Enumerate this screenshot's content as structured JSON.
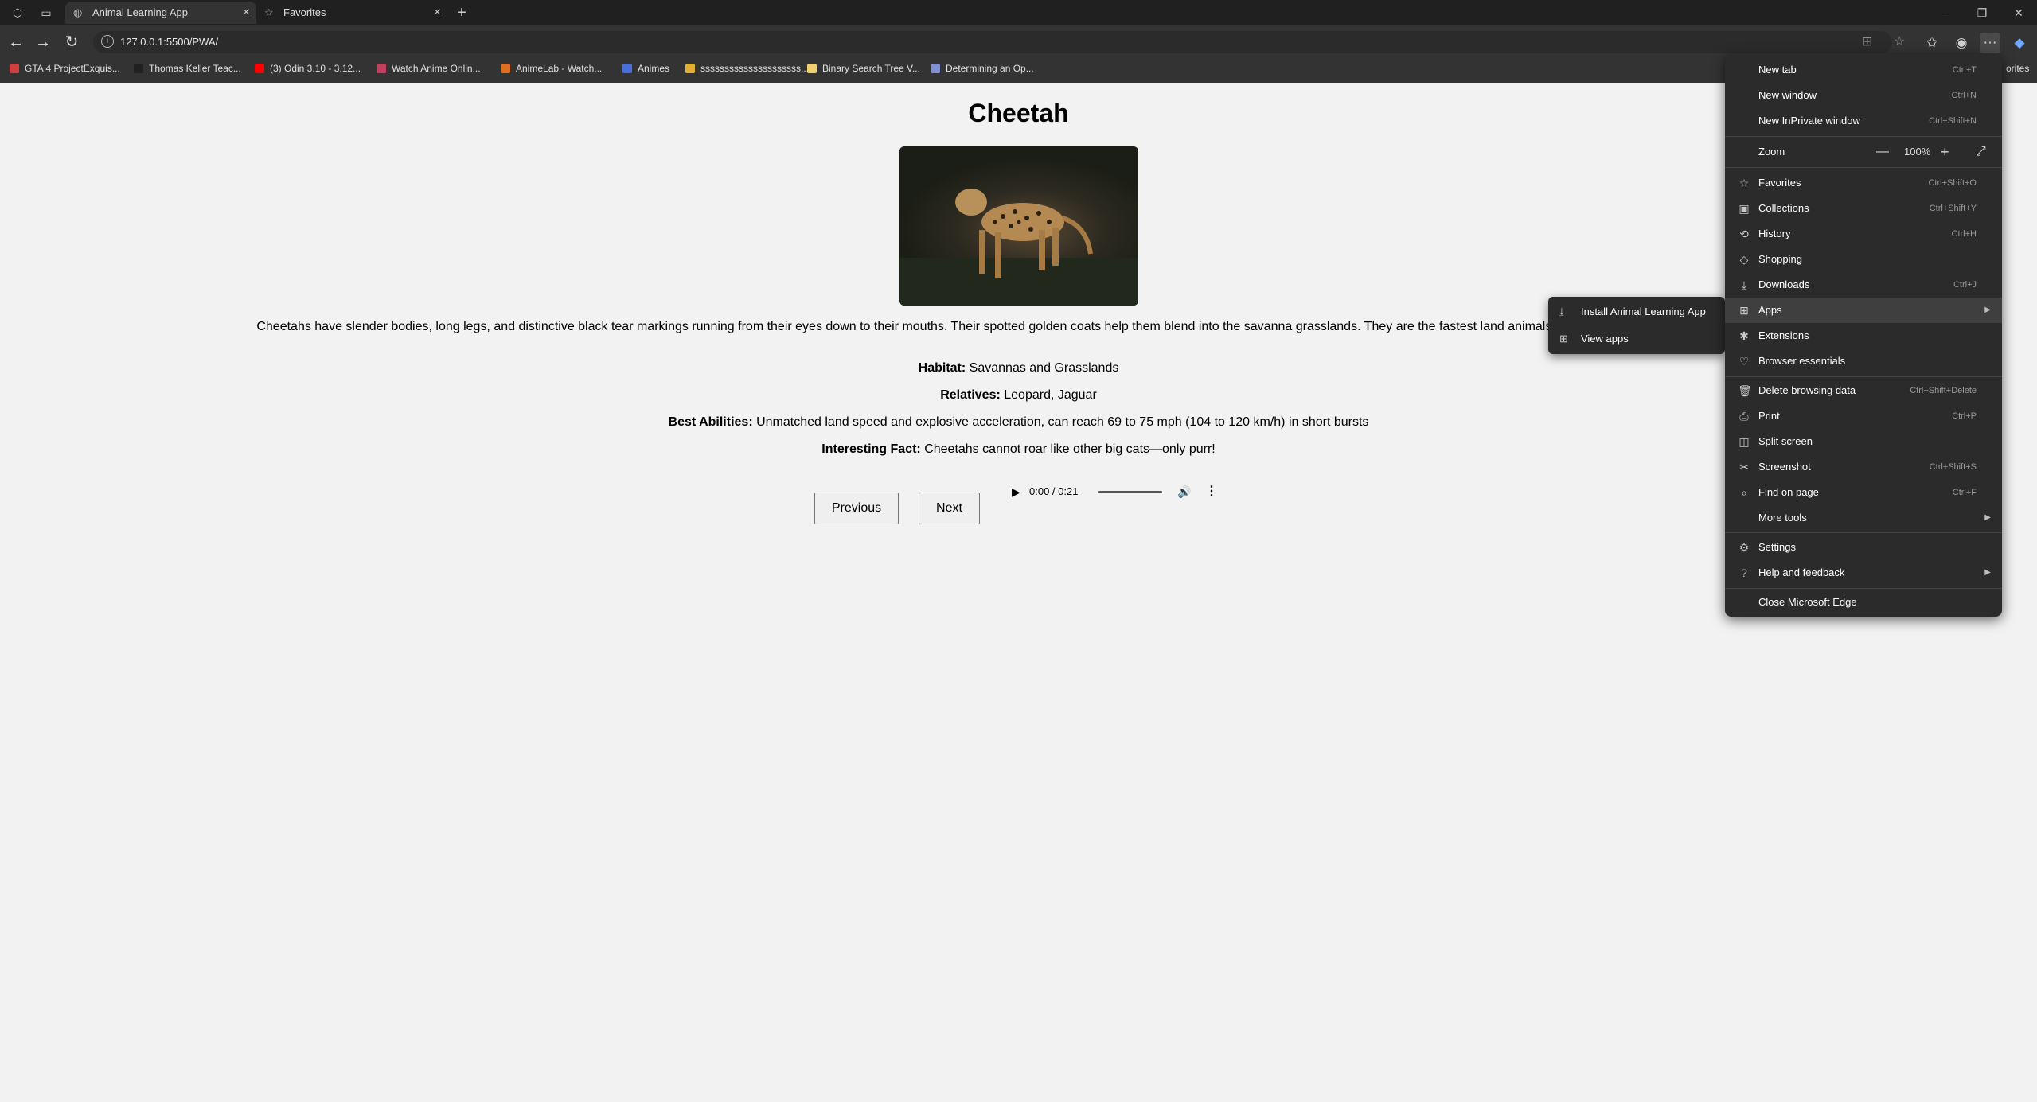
{
  "browser": {
    "tabs": [
      {
        "title": "Animal Learning App",
        "icon": "globe-icon"
      },
      {
        "title": "Favorites",
        "icon": "star-icon"
      }
    ],
    "url": "127.0.0.1:5500/PWA/",
    "bookmarks": [
      {
        "label": "GTA 4 ProjectExquis...",
        "color": "#d04040"
      },
      {
        "label": "Thomas Keller Teac...",
        "color": "#202020"
      },
      {
        "label": "(3) Odin 3.10 - 3.12...",
        "color": "#ff0000"
      },
      {
        "label": "Watch Anime Onlin...",
        "color": "#c04060"
      },
      {
        "label": "AnimeLab - Watch...",
        "color": "#e07020"
      },
      {
        "label": "Animes",
        "color": "#4a6fd8"
      },
      {
        "label": "sssssssssssssssssssss...",
        "color": "#e0b030"
      },
      {
        "label": "Binary Search Tree V...",
        "color": "#f0d070"
      },
      {
        "label": "Determining an Op...",
        "color": "#8090d0"
      }
    ],
    "bookmarks_overflow": "orites"
  },
  "page": {
    "animal_name": "Cheetah",
    "description": "Cheetahs have slender bodies, long legs, and distinctive black tear markings running from their eyes down to their mouths. Their spotted golden coats help them blend into the savanna grasslands. They are the fastest land animals, reaching 0 to 60 mph in just 3 seconds.",
    "facts": [
      {
        "label": "Habitat:",
        "value": "Savannas and Grasslands"
      },
      {
        "label": "Relatives:",
        "value": "Leopard, Jaguar"
      },
      {
        "label": "Best Abilities:",
        "value": "Unmatched land speed and explosive acceleration, can reach 69 to 75 mph (104 to 120 km/h) in short bursts"
      },
      {
        "label": "Interesting Fact:",
        "value": "Cheetahs cannot roar like other big cats—only purr!"
      }
    ],
    "buttons": {
      "previous": "Previous",
      "next": "Next"
    },
    "audio": {
      "time": "0:00 / 0:21"
    }
  },
  "menu": {
    "items": [
      {
        "label": "New tab",
        "shortcut": "Ctrl+T",
        "icon": ""
      },
      {
        "label": "New window",
        "shortcut": "Ctrl+N",
        "icon": ""
      },
      {
        "label": "New InPrivate window",
        "shortcut": "Ctrl+Shift+N",
        "icon": ""
      },
      {
        "label": "Zoom",
        "shortcut": "",
        "icon": "",
        "zoom": "100%"
      },
      {
        "label": "Favorites",
        "shortcut": "Ctrl+Shift+O",
        "icon": "☆"
      },
      {
        "label": "Collections",
        "shortcut": "Ctrl+Shift+Y",
        "icon": "▣"
      },
      {
        "label": "History",
        "shortcut": "Ctrl+H",
        "icon": "⟲"
      },
      {
        "label": "Shopping",
        "shortcut": "",
        "icon": "◇"
      },
      {
        "label": "Downloads",
        "shortcut": "Ctrl+J",
        "icon": "⤓"
      },
      {
        "label": "Apps",
        "shortcut": "",
        "icon": "⊞",
        "submenu": true
      },
      {
        "label": "Extensions",
        "shortcut": "",
        "icon": "✱"
      },
      {
        "label": "Browser essentials",
        "shortcut": "",
        "icon": "♡"
      },
      {
        "label": "Delete browsing data",
        "shortcut": "Ctrl+Shift+Delete",
        "icon": "🗑"
      },
      {
        "label": "Print",
        "shortcut": "Ctrl+P",
        "icon": "⎙"
      },
      {
        "label": "Split screen",
        "shortcut": "",
        "icon": "◫"
      },
      {
        "label": "Screenshot",
        "shortcut": "Ctrl+Shift+S",
        "icon": "✂"
      },
      {
        "label": "Find on page",
        "shortcut": "Ctrl+F",
        "icon": "⌕"
      },
      {
        "label": "More tools",
        "shortcut": "",
        "icon": "",
        "submenu": true
      },
      {
        "label": "Settings",
        "shortcut": "",
        "icon": "⚙"
      },
      {
        "label": "Help and feedback",
        "shortcut": "",
        "icon": "?",
        "submenu": true
      },
      {
        "label": "Close Microsoft Edge",
        "shortcut": "",
        "icon": ""
      }
    ],
    "apps_submenu": [
      {
        "label": "Install Animal Learning App",
        "icon": "⤓"
      },
      {
        "label": "View apps",
        "icon": "⊞"
      }
    ]
  }
}
